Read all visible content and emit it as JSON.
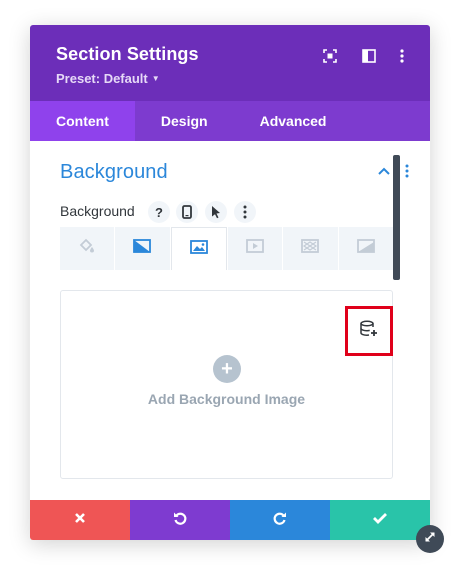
{
  "header": {
    "title": "Section Settings",
    "preset": "Preset: Default",
    "icons": [
      "screenshot-icon",
      "sidebar-layout-icon",
      "more-vertical-icon"
    ],
    "background_color": "#6c2eb9"
  },
  "tabs": [
    {
      "label": "Content",
      "active": true
    },
    {
      "label": "Design",
      "active": false
    },
    {
      "label": "Advanced",
      "active": false
    }
  ],
  "section": {
    "title": "Background",
    "field_label": "Background",
    "field_icons": [
      "help-icon",
      "mobile-icon",
      "hover-cursor-icon",
      "more-vertical-icon"
    ]
  },
  "background_tabs": [
    {
      "icon": "paint-bucket-icon",
      "active": false
    },
    {
      "icon": "gradient-icon",
      "active": false
    },
    {
      "icon": "image-icon",
      "active": true
    },
    {
      "icon": "video-icon",
      "active": false
    },
    {
      "icon": "pattern-icon",
      "active": false
    },
    {
      "icon": "mask-icon",
      "active": false
    }
  ],
  "upload": {
    "label": "Add Background Image",
    "plus": "+",
    "dynamic_content_icon": "dynamic-content-icon"
  },
  "footer": {
    "buttons": [
      {
        "name": "cancel",
        "color": "#ef5555"
      },
      {
        "name": "undo",
        "color": "#7e3bd0"
      },
      {
        "name": "redo",
        "color": "#2b87da"
      },
      {
        "name": "save",
        "color": "#29c4a9"
      }
    ]
  },
  "colors": {
    "accent_blue": "#2b87da",
    "highlight_red": "#e0001a",
    "tab_active": "#8f42ec"
  }
}
